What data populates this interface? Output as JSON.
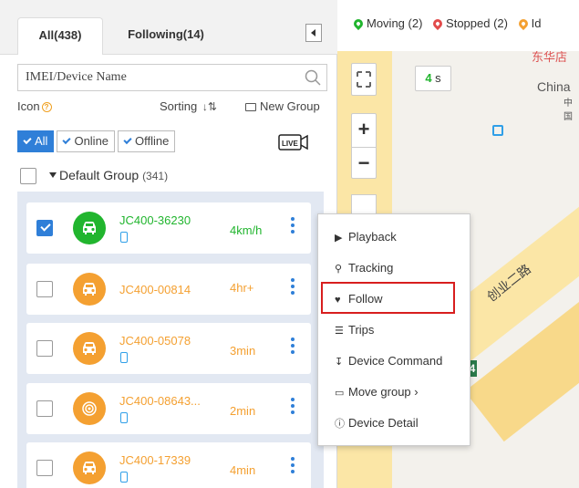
{
  "tabs": {
    "all": "All(438)",
    "following": "Following(14)"
  },
  "search": {
    "placeholder": "IMEI/Device Name"
  },
  "toolbar": {
    "icon_label": "Icon",
    "sorting_label": "Sorting",
    "new_group_label": "New Group"
  },
  "filters": {
    "all": "All",
    "online": "Online",
    "offline": "Offline",
    "selected": "All"
  },
  "group": {
    "name": "Default Group",
    "count": "(341)"
  },
  "devices": [
    {
      "name": "JC400-36230",
      "status": "4km/h",
      "state": "moving",
      "checked": true
    },
    {
      "name": "JC400-00814",
      "status": "4hr+",
      "state": "stopped",
      "checked": false
    },
    {
      "name": "JC400-05078",
      "status": "3min",
      "state": "stopped",
      "checked": false
    },
    {
      "name": "JC400-08643...",
      "status": "2min",
      "state": "idle",
      "checked": false
    },
    {
      "name": "JC400-17339",
      "status": "4min",
      "state": "stopped",
      "checked": false
    }
  ],
  "map": {
    "legend": {
      "moving": "Moving (2)",
      "stopped": "Stopped (2)",
      "idle": "Id"
    },
    "timer_value": "4",
    "timer_unit": "s",
    "zoom_in": "+",
    "zoom_out": "−",
    "street": "创业二路",
    "place_en": "China",
    "place_cn": "中国",
    "top_text": "东华店",
    "badge": "4"
  },
  "context_menu": {
    "playback": "Playback",
    "tracking": "Tracking",
    "follow": "Follow",
    "trips": "Trips",
    "device_command": "Device Command",
    "move_group": "Move group",
    "device_detail": "Device Detail"
  },
  "colors": {
    "moving": "#21b52e",
    "stopped": "#f4a031",
    "accent": "#2f7fd8",
    "highlight": "#d81e1e"
  }
}
